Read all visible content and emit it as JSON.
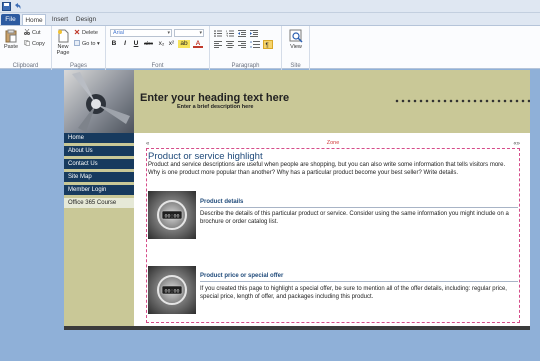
{
  "ribbon": {
    "tabs": [
      "File",
      "Home",
      "Insert",
      "Design"
    ],
    "clipboard": {
      "paste": "Paste",
      "cut": "Cut",
      "copy": "Copy",
      "label": "Clipboard"
    },
    "pages": {
      "new_page_line1": "New",
      "new_page_line2": "Page",
      "delete": "Delete",
      "goto": "Go to",
      "label": "Pages"
    },
    "font": {
      "name": "Arial",
      "size": "",
      "bold": "B",
      "italic": "I",
      "underline": "U",
      "strikethrough": "abc",
      "subscript": "x₂",
      "superscript": "x²",
      "highlight": "ab",
      "color": "A",
      "label": "Font"
    },
    "paragraph": {
      "label": "Paragraph"
    },
    "site": {
      "view": "View",
      "label": "Site"
    }
  },
  "page": {
    "heading": "Enter your heading text here",
    "subheading": "Enter a brief description here",
    "nav": [
      "Home",
      "About Us",
      "Contact Us",
      "Site Map",
      "Member Login",
      "Office 365 Course"
    ],
    "zone_label": "Zone",
    "section_title": "Product or service highlight",
    "intro": "Product and service descriptions are useful when people are shopping, but you can also write some information that tells visitors more. Why is one product more popular than another? Why has a particular product become your best seller? Write details.",
    "items": [
      {
        "title": "Product details",
        "text": "Describe the details of this particular product or service. Consider using the same information you might include on a brochure or order catalog list."
      },
      {
        "title": "Product price or special offer",
        "text": "If you created this page to highlight a special offer, be sure to mention all of the offer details, including: regular price, special price, length of offer, and packages including this product."
      }
    ]
  },
  "colors": {
    "header_bg": "#c9c897",
    "nav_bg": "#173a5e",
    "zone_border": "#d64d8a",
    "title_blue": "#1f4a7a",
    "workspace": "#8fb0d8"
  }
}
